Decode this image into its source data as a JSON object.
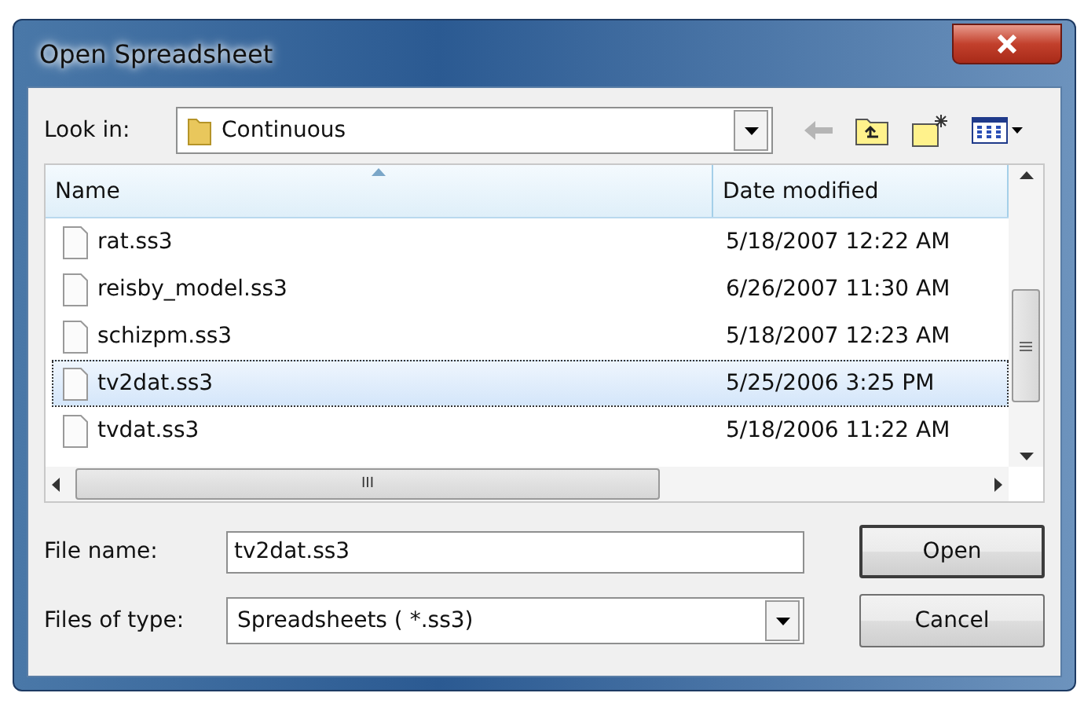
{
  "window": {
    "title": "Open Spreadsheet"
  },
  "look_in": {
    "label": "Look in:",
    "value": "Continuous"
  },
  "columns": [
    {
      "label": "Name",
      "sorted": true
    },
    {
      "label": "Date modified",
      "sorted": false
    }
  ],
  "files": [
    {
      "name": "rat.ss3",
      "date": "5/18/2007 12:22 AM",
      "selected": false
    },
    {
      "name": "reisby_model.ss3",
      "date": "6/26/2007 11:30 AM",
      "selected": false
    },
    {
      "name": "schizpm.ss3",
      "date": "5/18/2007 12:23 AM",
      "selected": false
    },
    {
      "name": "tv2dat.ss3",
      "date": "5/25/2006 3:25 PM",
      "selected": true
    },
    {
      "name": "tvdat.ss3",
      "date": "5/18/2006 11:22 AM",
      "selected": false
    }
  ],
  "file_name": {
    "label": "File name:",
    "value": "tv2dat.ss3"
  },
  "file_type": {
    "label": "Files of type:",
    "value": "Spreadsheets ( *.ss3)"
  },
  "buttons": [
    {
      "label": "Open",
      "default": true
    },
    {
      "label": "Cancel",
      "default": false
    }
  ],
  "scroll_glyph": "III"
}
